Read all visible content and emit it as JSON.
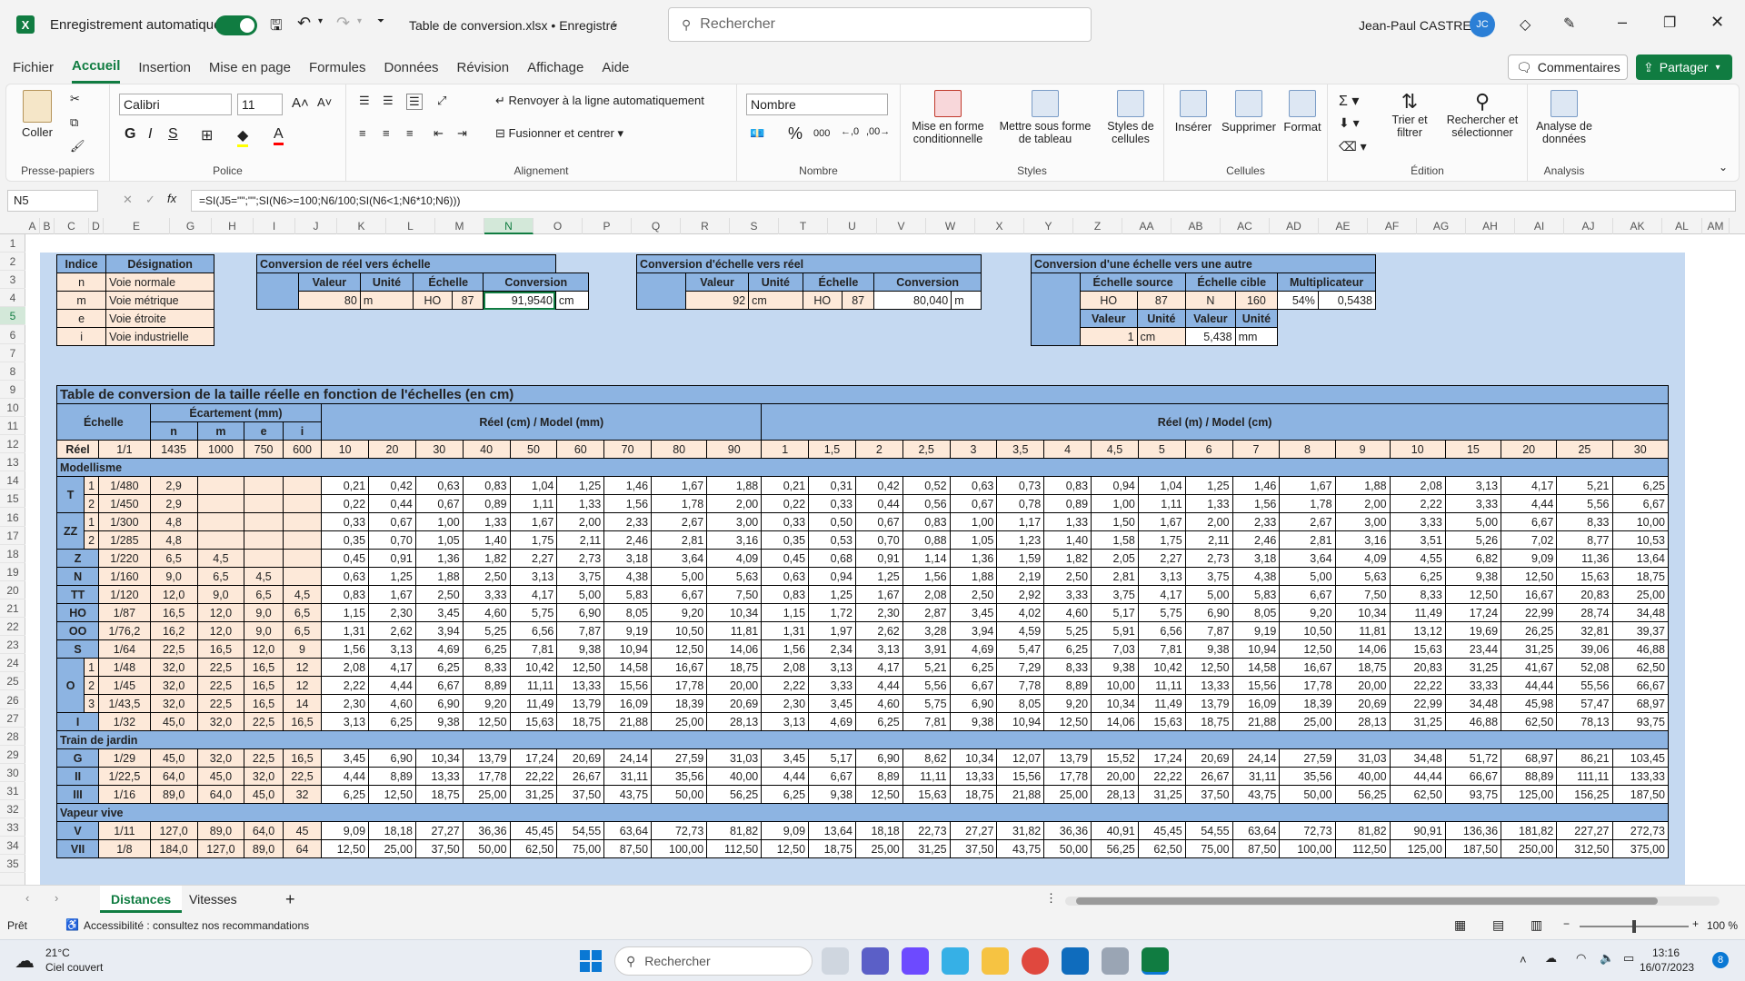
{
  "title": {
    "autosave": "Enregistrement automatique",
    "filename": "Table de conversion.xlsx • Enregistré",
    "search": "Rechercher",
    "user": "Jean-Paul CASTRE",
    "initials": "JC"
  },
  "menu": [
    "Fichier",
    "Accueil",
    "Insertion",
    "Mise en page",
    "Formules",
    "Données",
    "Révision",
    "Affichage",
    "Aide"
  ],
  "actions": {
    "comments": "Commentaires",
    "share": "Partager"
  },
  "ribbon": {
    "paste": "Coller",
    "clipboard": "Presse-papiers",
    "font": "Calibri",
    "size": "11",
    "font_group": "Police",
    "wrap": "Renvoyer à la ligne automatiquement",
    "merge": "Fusionner et centrer",
    "align_group": "Alignement",
    "numfmt": "Nombre",
    "number_group": "Nombre",
    "cond": "Mise en forme conditionnelle",
    "astable": "Mettre sous forme de tableau",
    "styles": "Styles de cellules",
    "styles_group": "Styles",
    "insert": "Insérer",
    "delete": "Supprimer",
    "format": "Format",
    "cells_group": "Cellules",
    "sort": "Trier et filtrer",
    "find": "Rechercher et sélectionner",
    "edit_group": "Édition",
    "analyze": "Analyse de données",
    "analysis_group": "Analysis"
  },
  "formula": {
    "cell": "N5",
    "fx": "fx",
    "text": "=SI(J5=\"\";\"\";SI(N6>=100;N6/100;SI(N6<1;N6*10;N6)))"
  },
  "columns": [
    "A",
    "B",
    "C",
    "D",
    "E",
    "G",
    "H",
    "I",
    "J",
    "K",
    "L",
    "M",
    "N",
    "O",
    "P",
    "Q",
    "R",
    "S",
    "T",
    "U",
    "V",
    "W",
    "X",
    "Y",
    "Z",
    "AA",
    "AB",
    "AC",
    "AD",
    "AE",
    "AF",
    "AG",
    "AH",
    "AI",
    "AJ",
    "AK",
    "AL",
    "AM"
  ],
  "rows": [
    "1",
    "2",
    "3",
    "4",
    "5",
    "6",
    "7",
    "8",
    "9",
    "10",
    "11",
    "12",
    "13",
    "14",
    "15",
    "16",
    "17",
    "18",
    "19",
    "20",
    "21",
    "22",
    "23",
    "24",
    "25",
    "26",
    "27",
    "28",
    "29",
    "30",
    "31",
    "32",
    "33",
    "34",
    "35"
  ],
  "legend": {
    "h1": "Indice",
    "h2": "Désignation",
    "items": [
      [
        "n",
        "Voie normale"
      ],
      [
        "m",
        "Voie métrique"
      ],
      [
        "e",
        "Voie étroite"
      ],
      [
        "i",
        "Voie industrielle"
      ]
    ]
  },
  "conv1": {
    "title": "Conversion de réel vers échelle",
    "h": [
      "Valeur",
      "Unité",
      "Échelle",
      "Conversion"
    ],
    "vals": [
      "80",
      "m",
      "HO",
      "87",
      "91,9540",
      "cm"
    ]
  },
  "conv2": {
    "title": "Conversion d'échelle vers réel",
    "h": [
      "Valeur",
      "Unité",
      "Échelle",
      "Conversion"
    ],
    "vals": [
      "92",
      "cm",
      "HO",
      "87",
      "80,040",
      "m"
    ]
  },
  "conv3": {
    "title": "Conversion d'une échelle vers une autre",
    "h": [
      "Échelle source",
      "Échelle cible",
      "Multiplicateur"
    ],
    "vals": [
      "HO",
      "87",
      "N",
      "160",
      "54%",
      "0,5438"
    ],
    "h2": [
      "Valeur",
      "Unité",
      "Valeur",
      "Unité"
    ],
    "vals2": [
      "1",
      "cm",
      "5,438",
      "mm"
    ]
  },
  "main": {
    "title": "Table de conversion de la taille réelle en fonction de l'échelles (en cm)",
    "echelle": "Échelle",
    "ecart": "Écartement (mm)",
    "g1": "Réel (cm) / Model (mm)",
    "g2": "Réel (m) / Model (cm)",
    "gauges": [
      "n",
      "m",
      "e",
      "i"
    ],
    "reel": "Réel",
    "reel_ratio": "1/1",
    "gauge_vals": [
      "1435",
      "1000",
      "750",
      "600"
    ],
    "cols_cm": [
      "10",
      "20",
      "30",
      "40",
      "50",
      "60",
      "70",
      "80",
      "90"
    ],
    "cols_m": [
      "1",
      "1,5",
      "2",
      "2,5",
      "3",
      "3,5",
      "4",
      "4,5",
      "5",
      "6",
      "7",
      "8",
      "9",
      "10",
      "15",
      "20",
      "25",
      "30"
    ],
    "rows": [
      {
        "sec": "Modellisme"
      },
      {
        "name": "T",
        "sub": "1",
        "ratio": "1/480",
        "g": [
          "2,9",
          "",
          "",
          ""
        ],
        "v": [
          "0,21",
          "0,42",
          "0,63",
          "0,83",
          "1,04",
          "1,25",
          "1,46",
          "1,67",
          "1,88",
          "0,21",
          "0,31",
          "0,42",
          "0,52",
          "0,63",
          "0,73",
          "0,83",
          "0,94",
          "1,04",
          "1,25",
          "1,46",
          "1,67",
          "1,88",
          "2,08",
          "3,13",
          "4,17",
          "5,21",
          "6,25"
        ]
      },
      {
        "name": "",
        "sub": "2",
        "ratio": "1/450",
        "g": [
          "2,9",
          "",
          "",
          ""
        ],
        "v": [
          "0,22",
          "0,44",
          "0,67",
          "0,89",
          "1,11",
          "1,33",
          "1,56",
          "1,78",
          "2,00",
          "0,22",
          "0,33",
          "0,44",
          "0,56",
          "0,67",
          "0,78",
          "0,89",
          "1,00",
          "1,11",
          "1,33",
          "1,56",
          "1,78",
          "2,00",
          "2,22",
          "3,33",
          "4,44",
          "5,56",
          "6,67"
        ]
      },
      {
        "name": "ZZ",
        "sub": "1",
        "ratio": "1/300",
        "g": [
          "4,8",
          "",
          "",
          ""
        ],
        "v": [
          "0,33",
          "0,67",
          "1,00",
          "1,33",
          "1,67",
          "2,00",
          "2,33",
          "2,67",
          "3,00",
          "0,33",
          "0,50",
          "0,67",
          "0,83",
          "1,00",
          "1,17",
          "1,33",
          "1,50",
          "1,67",
          "2,00",
          "2,33",
          "2,67",
          "3,00",
          "3,33",
          "5,00",
          "6,67",
          "8,33",
          "10,00"
        ]
      },
      {
        "name": "",
        "sub": "2",
        "ratio": "1/285",
        "g": [
          "4,8",
          "",
          "",
          ""
        ],
        "v": [
          "0,35",
          "0,70",
          "1,05",
          "1,40",
          "1,75",
          "2,11",
          "2,46",
          "2,81",
          "3,16",
          "0,35",
          "0,53",
          "0,70",
          "0,88",
          "1,05",
          "1,23",
          "1,40",
          "1,58",
          "1,75",
          "2,11",
          "2,46",
          "2,81",
          "3,16",
          "3,51",
          "5,26",
          "7,02",
          "8,77",
          "10,53"
        ]
      },
      {
        "name": "Z",
        "sub": "",
        "ratio": "1/220",
        "g": [
          "6,5",
          "4,5",
          "",
          ""
        ],
        "v": [
          "0,45",
          "0,91",
          "1,36",
          "1,82",
          "2,27",
          "2,73",
          "3,18",
          "3,64",
          "4,09",
          "0,45",
          "0,68",
          "0,91",
          "1,14",
          "1,36",
          "1,59",
          "1,82",
          "2,05",
          "2,27",
          "2,73",
          "3,18",
          "3,64",
          "4,09",
          "4,55",
          "6,82",
          "9,09",
          "11,36",
          "13,64"
        ]
      },
      {
        "name": "N",
        "sub": "",
        "ratio": "1/160",
        "g": [
          "9,0",
          "6,5",
          "4,5",
          ""
        ],
        "v": [
          "0,63",
          "1,25",
          "1,88",
          "2,50",
          "3,13",
          "3,75",
          "4,38",
          "5,00",
          "5,63",
          "0,63",
          "0,94",
          "1,25",
          "1,56",
          "1,88",
          "2,19",
          "2,50",
          "2,81",
          "3,13",
          "3,75",
          "4,38",
          "5,00",
          "5,63",
          "6,25",
          "9,38",
          "12,50",
          "15,63",
          "18,75"
        ]
      },
      {
        "name": "TT",
        "sub": "",
        "ratio": "1/120",
        "g": [
          "12,0",
          "9,0",
          "6,5",
          "4,5"
        ],
        "v": [
          "0,83",
          "1,67",
          "2,50",
          "3,33",
          "4,17",
          "5,00",
          "5,83",
          "6,67",
          "7,50",
          "0,83",
          "1,25",
          "1,67",
          "2,08",
          "2,50",
          "2,92",
          "3,33",
          "3,75",
          "4,17",
          "5,00",
          "5,83",
          "6,67",
          "7,50",
          "8,33",
          "12,50",
          "16,67",
          "20,83",
          "25,00"
        ]
      },
      {
        "name": "HO",
        "sub": "",
        "ratio": "1/87",
        "g": [
          "16,5",
          "12,0",
          "9,0",
          "6,5"
        ],
        "v": [
          "1,15",
          "2,30",
          "3,45",
          "4,60",
          "5,75",
          "6,90",
          "8,05",
          "9,20",
          "10,34",
          "1,15",
          "1,72",
          "2,30",
          "2,87",
          "3,45",
          "4,02",
          "4,60",
          "5,17",
          "5,75",
          "6,90",
          "8,05",
          "9,20",
          "10,34",
          "11,49",
          "17,24",
          "22,99",
          "28,74",
          "34,48"
        ]
      },
      {
        "name": "OO",
        "sub": "",
        "ratio": "1/76,2",
        "g": [
          "16,2",
          "12,0",
          "9,0",
          "6,5"
        ],
        "v": [
          "1,31",
          "2,62",
          "3,94",
          "5,25",
          "6,56",
          "7,87",
          "9,19",
          "10,50",
          "11,81",
          "1,31",
          "1,97",
          "2,62",
          "3,28",
          "3,94",
          "4,59",
          "5,25",
          "5,91",
          "6,56",
          "7,87",
          "9,19",
          "10,50",
          "11,81",
          "13,12",
          "19,69",
          "26,25",
          "32,81",
          "39,37"
        ]
      },
      {
        "name": "S",
        "sub": "",
        "ratio": "1/64",
        "g": [
          "22,5",
          "16,5",
          "12,0",
          "9"
        ],
        "v": [
          "1,56",
          "3,13",
          "4,69",
          "6,25",
          "7,81",
          "9,38",
          "10,94",
          "12,50",
          "14,06",
          "1,56",
          "2,34",
          "3,13",
          "3,91",
          "4,69",
          "5,47",
          "6,25",
          "7,03",
          "7,81",
          "9,38",
          "10,94",
          "12,50",
          "14,06",
          "15,63",
          "23,44",
          "31,25",
          "39,06",
          "46,88"
        ]
      },
      {
        "name": "O",
        "sub": "1",
        "ratio": "1/48",
        "g": [
          "32,0",
          "22,5",
          "16,5",
          "12"
        ],
        "v": [
          "2,08",
          "4,17",
          "6,25",
          "8,33",
          "10,42",
          "12,50",
          "14,58",
          "16,67",
          "18,75",
          "2,08",
          "3,13",
          "4,17",
          "5,21",
          "6,25",
          "7,29",
          "8,33",
          "9,38",
          "10,42",
          "12,50",
          "14,58",
          "16,67",
          "18,75",
          "20,83",
          "31,25",
          "41,67",
          "52,08",
          "62,50"
        ]
      },
      {
        "name": "",
        "sub": "2",
        "ratio": "1/45",
        "g": [
          "32,0",
          "22,5",
          "16,5",
          "12"
        ],
        "v": [
          "2,22",
          "4,44",
          "6,67",
          "8,89",
          "11,11",
          "13,33",
          "15,56",
          "17,78",
          "20,00",
          "2,22",
          "3,33",
          "4,44",
          "5,56",
          "6,67",
          "7,78",
          "8,89",
          "10,00",
          "11,11",
          "13,33",
          "15,56",
          "17,78",
          "20,00",
          "22,22",
          "33,33",
          "44,44",
          "55,56",
          "66,67"
        ]
      },
      {
        "name": "",
        "sub": "3",
        "ratio": "1/43,5",
        "g": [
          "32,0",
          "22,5",
          "16,5",
          "14"
        ],
        "v": [
          "2,30",
          "4,60",
          "6,90",
          "9,20",
          "11,49",
          "13,79",
          "16,09",
          "18,39",
          "20,69",
          "2,30",
          "3,45",
          "4,60",
          "5,75",
          "6,90",
          "8,05",
          "9,20",
          "10,34",
          "11,49",
          "13,79",
          "16,09",
          "18,39",
          "20,69",
          "22,99",
          "34,48",
          "45,98",
          "57,47",
          "68,97"
        ]
      },
      {
        "name": "I",
        "sub": "",
        "ratio": "1/32",
        "g": [
          "45,0",
          "32,0",
          "22,5",
          "16,5"
        ],
        "v": [
          "3,13",
          "6,25",
          "9,38",
          "12,50",
          "15,63",
          "18,75",
          "21,88",
          "25,00",
          "28,13",
          "3,13",
          "4,69",
          "6,25",
          "7,81",
          "9,38",
          "10,94",
          "12,50",
          "14,06",
          "15,63",
          "18,75",
          "21,88",
          "25,00",
          "28,13",
          "31,25",
          "46,88",
          "62,50",
          "78,13",
          "93,75"
        ]
      },
      {
        "sec": "Train de jardin"
      },
      {
        "name": "G",
        "sub": "",
        "ratio": "1/29",
        "g": [
          "45,0",
          "32,0",
          "22,5",
          "16,5"
        ],
        "v": [
          "3,45",
          "6,90",
          "10,34",
          "13,79",
          "17,24",
          "20,69",
          "24,14",
          "27,59",
          "31,03",
          "3,45",
          "5,17",
          "6,90",
          "8,62",
          "10,34",
          "12,07",
          "13,79",
          "15,52",
          "17,24",
          "20,69",
          "24,14",
          "27,59",
          "31,03",
          "34,48",
          "51,72",
          "68,97",
          "86,21",
          "103,45"
        ]
      },
      {
        "name": "II",
        "sub": "",
        "ratio": "1/22,5",
        "g": [
          "64,0",
          "45,0",
          "32,0",
          "22,5"
        ],
        "v": [
          "4,44",
          "8,89",
          "13,33",
          "17,78",
          "22,22",
          "26,67",
          "31,11",
          "35,56",
          "40,00",
          "4,44",
          "6,67",
          "8,89",
          "11,11",
          "13,33",
          "15,56",
          "17,78",
          "20,00",
          "22,22",
          "26,67",
          "31,11",
          "35,56",
          "40,00",
          "44,44",
          "66,67",
          "88,89",
          "111,11",
          "133,33"
        ]
      },
      {
        "name": "III",
        "sub": "",
        "ratio": "1/16",
        "g": [
          "89,0",
          "64,0",
          "45,0",
          "32"
        ],
        "v": [
          "6,25",
          "12,50",
          "18,75",
          "25,00",
          "31,25",
          "37,50",
          "43,75",
          "50,00",
          "56,25",
          "6,25",
          "9,38",
          "12,50",
          "15,63",
          "18,75",
          "21,88",
          "25,00",
          "28,13",
          "31,25",
          "37,50",
          "43,75",
          "50,00",
          "56,25",
          "62,50",
          "93,75",
          "125,00",
          "156,25",
          "187,50"
        ]
      },
      {
        "sec": "Vapeur vive"
      },
      {
        "name": "V",
        "sub": "",
        "ratio": "1/11",
        "g": [
          "127,0",
          "89,0",
          "64,0",
          "45"
        ],
        "v": [
          "9,09",
          "18,18",
          "27,27",
          "36,36",
          "45,45",
          "54,55",
          "63,64",
          "72,73",
          "81,82",
          "9,09",
          "13,64",
          "18,18",
          "22,73",
          "27,27",
          "31,82",
          "36,36",
          "40,91",
          "45,45",
          "54,55",
          "63,64",
          "72,73",
          "81,82",
          "90,91",
          "136,36",
          "181,82",
          "227,27",
          "272,73"
        ]
      },
      {
        "name": "VII",
        "sub": "",
        "ratio": "1/8",
        "g": [
          "184,0",
          "127,0",
          "89,0",
          "64"
        ],
        "v": [
          "12,50",
          "25,00",
          "37,50",
          "50,00",
          "62,50",
          "75,00",
          "87,50",
          "100,00",
          "112,50",
          "12,50",
          "18,75",
          "25,00",
          "31,25",
          "37,50",
          "43,75",
          "50,00",
          "56,25",
          "62,50",
          "75,00",
          "87,50",
          "100,00",
          "112,50",
          "125,00",
          "187,50",
          "250,00",
          "312,50",
          "375,00"
        ]
      }
    ]
  },
  "sheets": [
    "Distances",
    "Vitesses"
  ],
  "status": {
    "ready": "Prêt",
    "access": "Accessibilité : consultez nos recommandations",
    "zoom": "100 %"
  },
  "taskbar": {
    "temp": "21°C",
    "weather": "Ciel couvert",
    "search": "Rechercher",
    "time": "13:16",
    "date": "16/07/2023",
    "notif": "8"
  }
}
